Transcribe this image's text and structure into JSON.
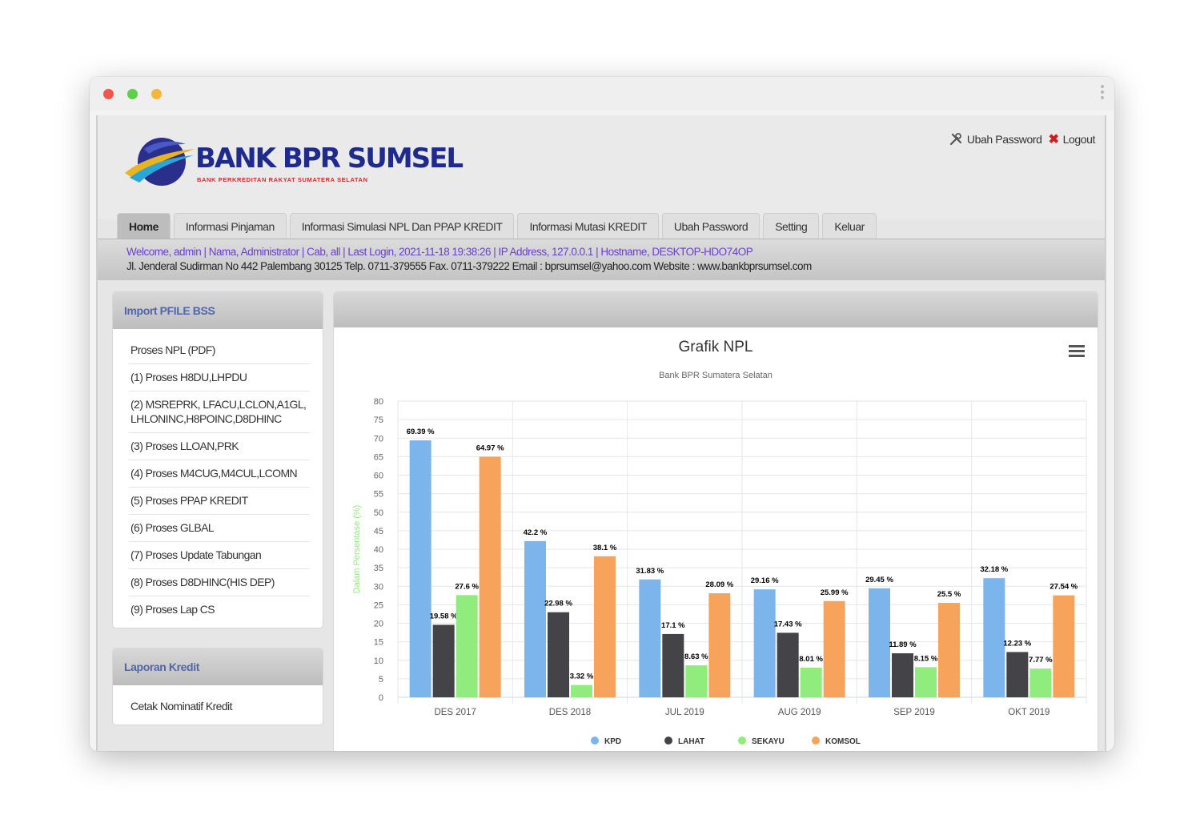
{
  "window": {
    "controls": [
      "close",
      "minimize",
      "zoom"
    ]
  },
  "brand": {
    "name": "BANK BPR SUMSEL",
    "tagline": "BANK PERKREDITAN RAKYAT SUMATERA SELATAN"
  },
  "header_links": {
    "change_password": "Ubah Password",
    "logout": "Logout"
  },
  "nav": {
    "tabs": [
      {
        "label": "Home",
        "active": true
      },
      {
        "label": "Informasi Pinjaman"
      },
      {
        "label": "Informasi Simulasi NPL Dan PPAP KREDIT"
      },
      {
        "label": "Informasi Mutasi KREDIT"
      },
      {
        "label": "Ubah Password"
      },
      {
        "label": "Setting"
      },
      {
        "label": "Keluar"
      }
    ]
  },
  "info": {
    "welcome": "Welcome, admin | Nama, Administrator | Cab, all | Last Login, 2021-11-18 19:38:26 | IP Address, 127.0.0.1 | Hostname, DESKTOP-HDO74OP",
    "address": "Jl. Jenderal Sudirman No 442 Palembang 30125 Telp. 0711-379555 Fax. 0711-379222 Email : bprsumsel@yahoo.com Website : www.bankbprsumsel.com"
  },
  "sidebar": {
    "panels": [
      {
        "title": "Import PFILE BSS",
        "items": [
          "Proses NPL (PDF)",
          "(1) Proses H8DU,LHPDU",
          "(2) MSREPRK, LFACU,LCLON,A1GL, LHLONINC,H8POINC,D8DHINC",
          "(3) Proses LLOAN,PRK",
          "(4) Proses M4CUG,M4CUL,LCOMN",
          "(5) Proses PPAP KREDIT",
          "(6) Proses GLBAL",
          "(7) Proses Update Tabungan",
          "(8) Proses D8DHINC(HIS DEP)",
          "(9) Proses Lap CS"
        ]
      },
      {
        "title": "Laporan Kredit",
        "items": [
          "Cetak Nominatif Kredit"
        ]
      }
    ]
  },
  "chart_data": {
    "type": "bar",
    "title": "Grafik NPL",
    "subtitle": "Bank BPR Sumatera Selatan",
    "ylabel": "Dalam Persentase (%)",
    "xlabel": "",
    "ylim": [
      0,
      80
    ],
    "yticks": [
      0,
      5,
      10,
      15,
      20,
      25,
      30,
      35,
      40,
      45,
      50,
      55,
      60,
      65,
      70,
      75,
      80
    ],
    "grid": true,
    "legend": "bottom",
    "categories": [
      "DES 2017",
      "DES 2018",
      "JUL 2019",
      "AUG 2019",
      "SEP 2019",
      "OKT 2019"
    ],
    "series": [
      {
        "name": "KPD",
        "color": "#7cb5ec",
        "values": [
          69.39,
          42.2,
          31.83,
          29.16,
          29.45,
          32.18
        ],
        "labels": [
          "69.39 %",
          "42.2 %",
          "31.83 %",
          "29.16 %",
          "29.45 %",
          "32.18 %"
        ]
      },
      {
        "name": "LAHAT",
        "color": "#434348",
        "values": [
          19.58,
          22.98,
          17.1,
          17.43,
          11.89,
          12.23
        ],
        "labels": [
          "19.58 %",
          "22.98 %",
          "17.1 %",
          "17.43 %",
          "11.89 %",
          "12.23 %"
        ]
      },
      {
        "name": "SEKAYU",
        "color": "#90ed7d",
        "values": [
          27.6,
          3.32,
          8.63,
          8.01,
          8.15,
          7.77
        ],
        "labels": [
          "27.6 %",
          "3.32 %",
          "8.63 %",
          "8.01 %",
          "8.15 %",
          "7.77 %"
        ]
      },
      {
        "name": "KOMSOL",
        "color": "#f7a35c",
        "values": [
          64.97,
          38.1,
          28.09,
          25.99,
          25.5,
          27.54
        ],
        "labels": [
          "64.97 %",
          "38.1 %",
          "28.09 %",
          "25.99 %",
          "25.5 %",
          "27.54 %"
        ]
      }
    ]
  }
}
